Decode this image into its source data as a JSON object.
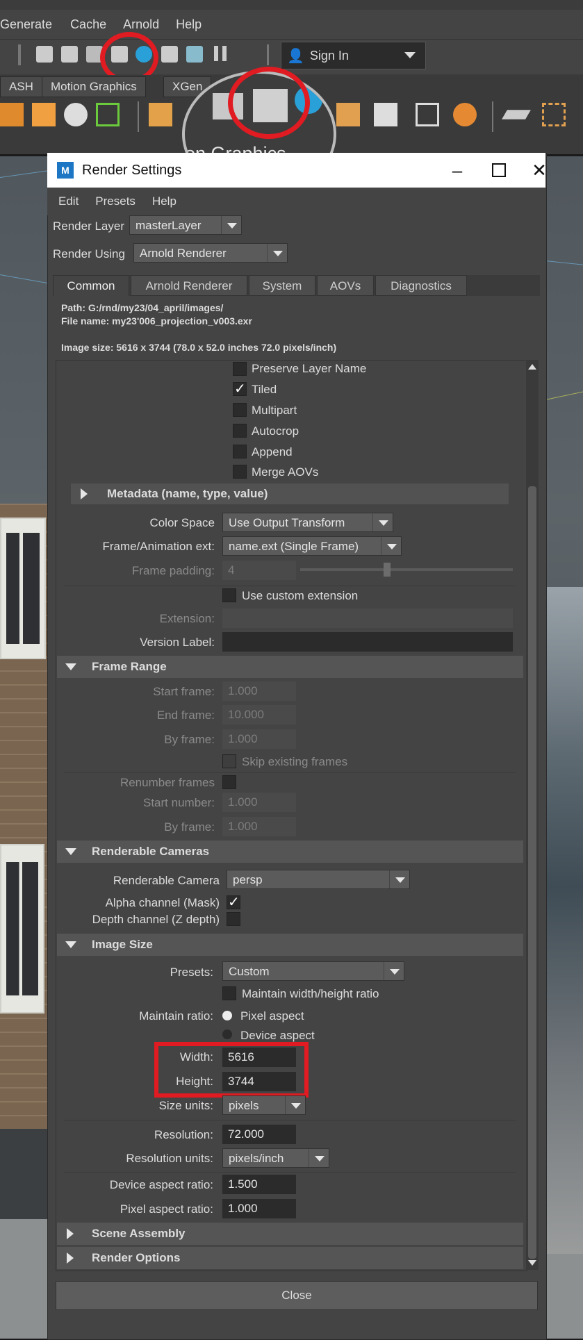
{
  "maya": {
    "menu": [
      "Generate",
      "Cache",
      "Arnold",
      "Help"
    ],
    "sign_in": "Sign In",
    "shelf_tabs": [
      "ASH",
      "Motion Graphics",
      "XGen"
    ],
    "magnifier_text": "on Graphics"
  },
  "dialog": {
    "title": "Render Settings",
    "menu": [
      "Edit",
      "Presets",
      "Help"
    ],
    "render_layer_label": "Render Layer",
    "render_layer_value": "masterLayer",
    "render_using_label": "Render Using",
    "render_using_value": "Arnold Renderer",
    "tabs": [
      "Common",
      "Arnold Renderer",
      "System",
      "AOVs",
      "Diagnostics"
    ],
    "path_line": "Path: G:/rnd/my23/04_april/images/",
    "file_line": "File name:  my23'006_projection_v003.exr",
    "image_size_line": "Image size: 5616 x 3744 (78.0 x 52.0 inches 72.0 pixels/inch)",
    "close_label": "Close"
  },
  "file_output": {
    "checkboxes": [
      {
        "label": "Preserve Layer Name",
        "checked": false
      },
      {
        "label": "Tiled",
        "checked": true
      },
      {
        "label": "Multipart",
        "checked": false
      },
      {
        "label": "Autocrop",
        "checked": false
      },
      {
        "label": "Append",
        "checked": false
      },
      {
        "label": "Merge AOVs",
        "checked": false
      }
    ],
    "metadata_label": "Metadata (name, type, value)",
    "color_space_label": "Color Space",
    "color_space_value": "Use Output Transform",
    "frame_ext_label": "Frame/Animation ext:",
    "frame_ext_value": "name.ext (Single Frame)",
    "frame_padding_label": "Frame padding:",
    "frame_padding_value": "4",
    "use_custom_ext_label": "Use custom extension",
    "extension_label": "Extension:",
    "version_label": "Version Label:"
  },
  "frame_range": {
    "title": "Frame Range",
    "start_frame_label": "Start frame:",
    "start_frame": "1.000",
    "end_frame_label": "End frame:",
    "end_frame": "10.000",
    "by_frame_label": "By frame:",
    "by_frame": "1.000",
    "skip_label": "Skip existing frames",
    "renumber_label": "Renumber frames",
    "start_number_label": "Start number:",
    "start_number": "1.000",
    "by_frame2_label": "By frame:",
    "by_frame2": "1.000"
  },
  "cameras": {
    "title": "Renderable Cameras",
    "camera_label": "Renderable Camera",
    "camera_value": "persp",
    "alpha_label": "Alpha channel (Mask)",
    "depth_label": "Depth channel (Z depth)"
  },
  "image_size": {
    "title": "Image Size",
    "presets_label": "Presets:",
    "presets_value": "Custom",
    "maintain_wh_label": "Maintain width/height ratio",
    "maintain_ratio_label": "Maintain ratio:",
    "pixel_aspect_label": "Pixel aspect",
    "device_aspect_label": "Device aspect",
    "width_label": "Width:",
    "width": "5616",
    "height_label": "Height:",
    "height": "3744",
    "size_units_label": "Size units:",
    "size_units": "pixels",
    "resolution_label": "Resolution:",
    "resolution": "72.000",
    "res_units_label": "Resolution units:",
    "res_units": "pixels/inch",
    "device_aspect_ratio_label": "Device aspect ratio:",
    "device_aspect_ratio": "1.500",
    "pixel_aspect_ratio_label": "Pixel aspect ratio:",
    "pixel_aspect_ratio": "1.000"
  },
  "collapsed_sections": [
    "Scene Assembly",
    "Render Options"
  ],
  "colors": {
    "highlight": "#e01b22",
    "panel": "#444444",
    "field": "#2b2b2b"
  }
}
